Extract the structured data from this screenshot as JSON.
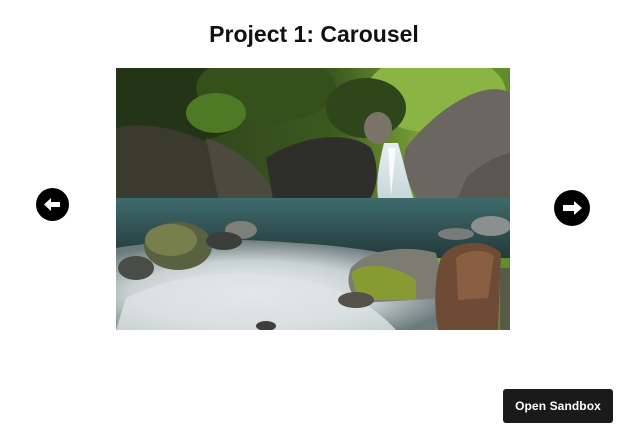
{
  "page": {
    "title": "Project 1: Carousel"
  },
  "carousel": {
    "image_subject": "waterfall-over-mossy-rocks-photo",
    "prev_icon": "arrow-left-icon",
    "next_icon": "arrow-right-icon"
  },
  "sandbox": {
    "label": "Open Sandbox"
  },
  "colors": {
    "button_bg": "#000000",
    "sandbox_bg": "#1a1a1a",
    "text": "#111111"
  }
}
